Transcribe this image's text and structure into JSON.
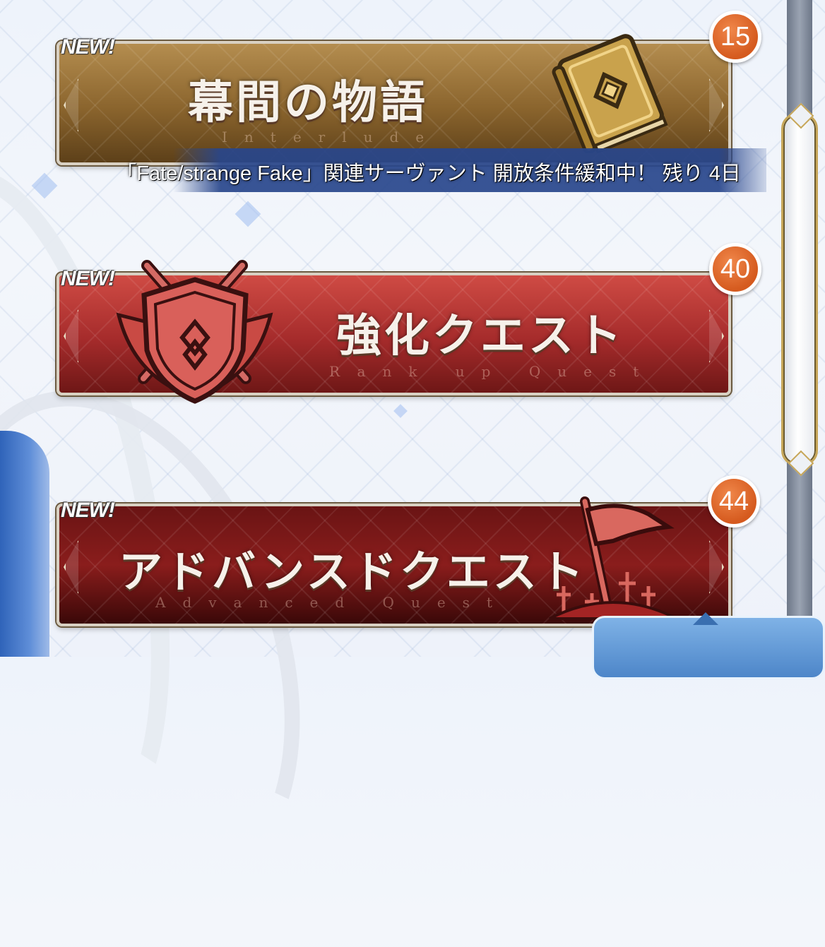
{
  "banners": [
    {
      "id": "interlude",
      "title": "幕間の物語",
      "subtitle": "Interlude",
      "new_label": "NEW!",
      "badge_count": "15",
      "notice": "「Fate/strange Fake」関連サーヴァント 開放条件緩和中！ 残り 4日",
      "icon": "book-icon"
    },
    {
      "id": "rank-up",
      "title": "強化クエスト",
      "subtitle": "Rank up Quest",
      "new_label": "NEW!",
      "badge_count": "40",
      "icon": "shield-swords-icon"
    },
    {
      "id": "advanced",
      "title": "アドバンスドクエスト",
      "subtitle": "Advanced Quest",
      "new_label": "NEW!",
      "badge_count": "44",
      "icon": "flag-icon"
    }
  ],
  "colors": {
    "interlude_bg": "#8a642d",
    "rankup_bg": "#a52b2b",
    "advanced_bg": "#6a1414",
    "badge": "#e0652a",
    "notice_bg": "#284690"
  }
}
